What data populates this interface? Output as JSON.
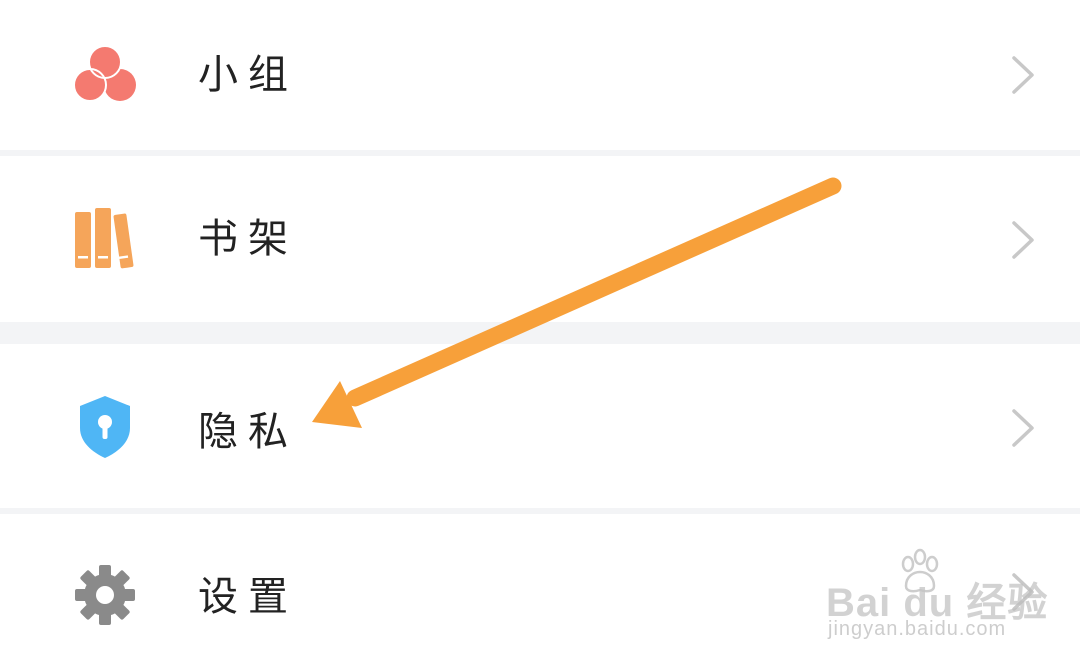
{
  "menu": {
    "items": [
      {
        "label": "小组",
        "icon": "group-icon",
        "color": "#f47a70"
      },
      {
        "label": "书架",
        "icon": "bookshelf-icon",
        "color": "#f5a55a"
      },
      {
        "label": "隐私",
        "icon": "shield-lock-icon",
        "color": "#4fb6f5"
      },
      {
        "label": "设置",
        "icon": "gear-icon",
        "color": "#8a8a8a"
      }
    ]
  },
  "annotation": {
    "arrow_color": "#f7a03a"
  },
  "watermark": {
    "logo_text": "Bai  du 经验",
    "url": "jingyan.baidu.com"
  }
}
